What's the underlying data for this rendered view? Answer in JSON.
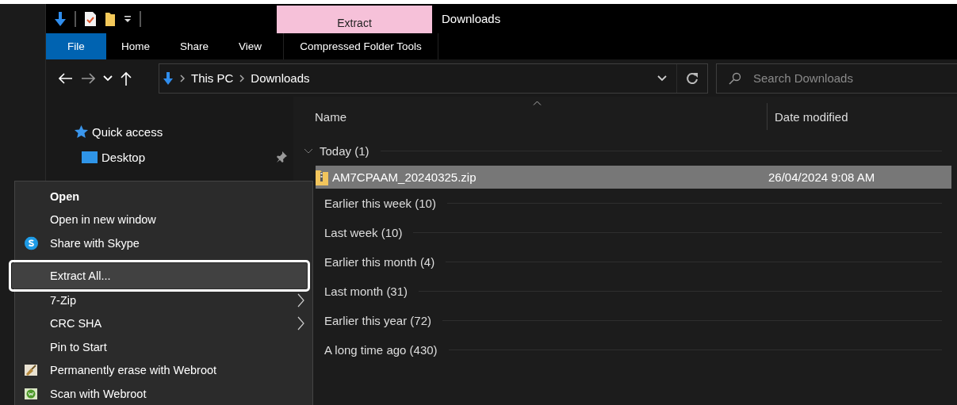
{
  "window": {
    "title": "Downloads",
    "context_group": "Extract"
  },
  "ribbon_tabs": [
    {
      "label": "File",
      "selected": true
    },
    {
      "label": "Home",
      "selected": false
    },
    {
      "label": "Share",
      "selected": false
    },
    {
      "label": "View",
      "selected": false
    },
    {
      "label": "Compressed Folder Tools",
      "selected": false
    }
  ],
  "address_bar": {
    "path": [
      "This PC",
      "Downloads"
    ]
  },
  "search": {
    "placeholder": "Search Downloads"
  },
  "nav_pane": {
    "items": [
      {
        "label": "Quick access",
        "pinned": false
      },
      {
        "label": "Desktop",
        "pinned": true
      }
    ]
  },
  "file_list": {
    "columns": [
      "Name",
      "Date modified"
    ],
    "groups": [
      {
        "label": "Today (1)",
        "expanded": true,
        "files": [
          {
            "name": "AM7CPAAM_20240325.zip",
            "date_modified": "26/04/2024 9:08 AM",
            "selected": true
          }
        ]
      },
      {
        "label": "Earlier this week (10)",
        "expanded": false
      },
      {
        "label": "Last week (10)",
        "expanded": false
      },
      {
        "label": "Earlier this month (4)",
        "expanded": false
      },
      {
        "label": "Last month (31)",
        "expanded": false
      },
      {
        "label": "Earlier this year (72)",
        "expanded": false
      },
      {
        "label": "A long time ago (430)",
        "expanded": false
      }
    ]
  },
  "context_menu": {
    "items": [
      {
        "label": "Open",
        "default": true,
        "submenu": false,
        "selected": false
      },
      {
        "label": "Open in new window",
        "default": false,
        "submenu": false,
        "selected": false
      },
      {
        "label": "Share with Skype",
        "default": false,
        "submenu": false,
        "selected": false
      },
      {
        "label": "Extract All...",
        "default": false,
        "submenu": false,
        "selected": true
      },
      {
        "label": "7-Zip",
        "default": false,
        "submenu": true,
        "selected": false
      },
      {
        "label": "CRC SHA",
        "default": false,
        "submenu": true,
        "selected": false
      },
      {
        "label": "Pin to Start",
        "default": false,
        "submenu": false,
        "selected": false
      },
      {
        "label": "Permanently erase with Webroot",
        "default": false,
        "submenu": false,
        "selected": false
      },
      {
        "label": "Scan with Webroot",
        "default": false,
        "submenu": false,
        "selected": false
      }
    ]
  }
}
